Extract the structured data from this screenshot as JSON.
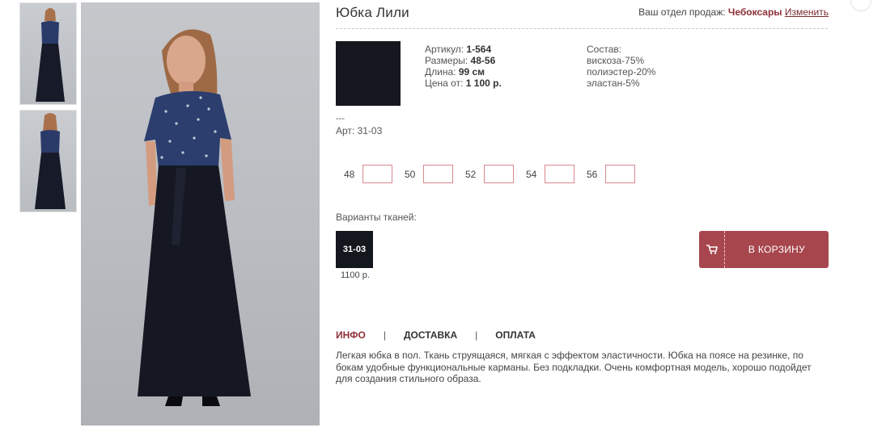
{
  "product": {
    "title": "Юбка Лили",
    "sales_dept_label": "Ваш отдел продаж:",
    "city": "Чебоксары",
    "change_link": "Изменить",
    "article_label": "Артикул:",
    "article_value": "1-564",
    "sizes_label": "Размеры:",
    "sizes_value": "48-56",
    "length_label": "Длина:",
    "length_value": "99 см",
    "price_label": "Цена от:",
    "price_value": "1 100 р.",
    "composition_label": "Состав:",
    "composition": [
      "вискоза-75%",
      "полиэстер-20%",
      "эластан-5%"
    ],
    "dash": "---",
    "art_code": "Арт: 31-03"
  },
  "sizes": [
    "48",
    "50",
    "52",
    "54",
    "56"
  ],
  "fabrics": {
    "label": "Варианты тканей:",
    "items": [
      {
        "code": "31-03",
        "price": "1100 р."
      }
    ]
  },
  "cart": {
    "label": "В КОРЗИНУ",
    "icon": "cart-icon"
  },
  "tabs": [
    "ИНФО",
    "ДОСТАВКА",
    "ОПЛАТА"
  ],
  "tab_separator": "|",
  "description": "Легкая юбка в пол. Ткань струящаяся, мягкая с эффектом эластичности. Юбка на поясе на резинке, по бокам удобные функциональные карманы. Без подкладки. Очень комфортная модель, хорошо подойдет для создания стильного образа.",
  "colors": {
    "accent": "#a8464e",
    "link": "#8e2f36",
    "fabric": "#15171e"
  }
}
